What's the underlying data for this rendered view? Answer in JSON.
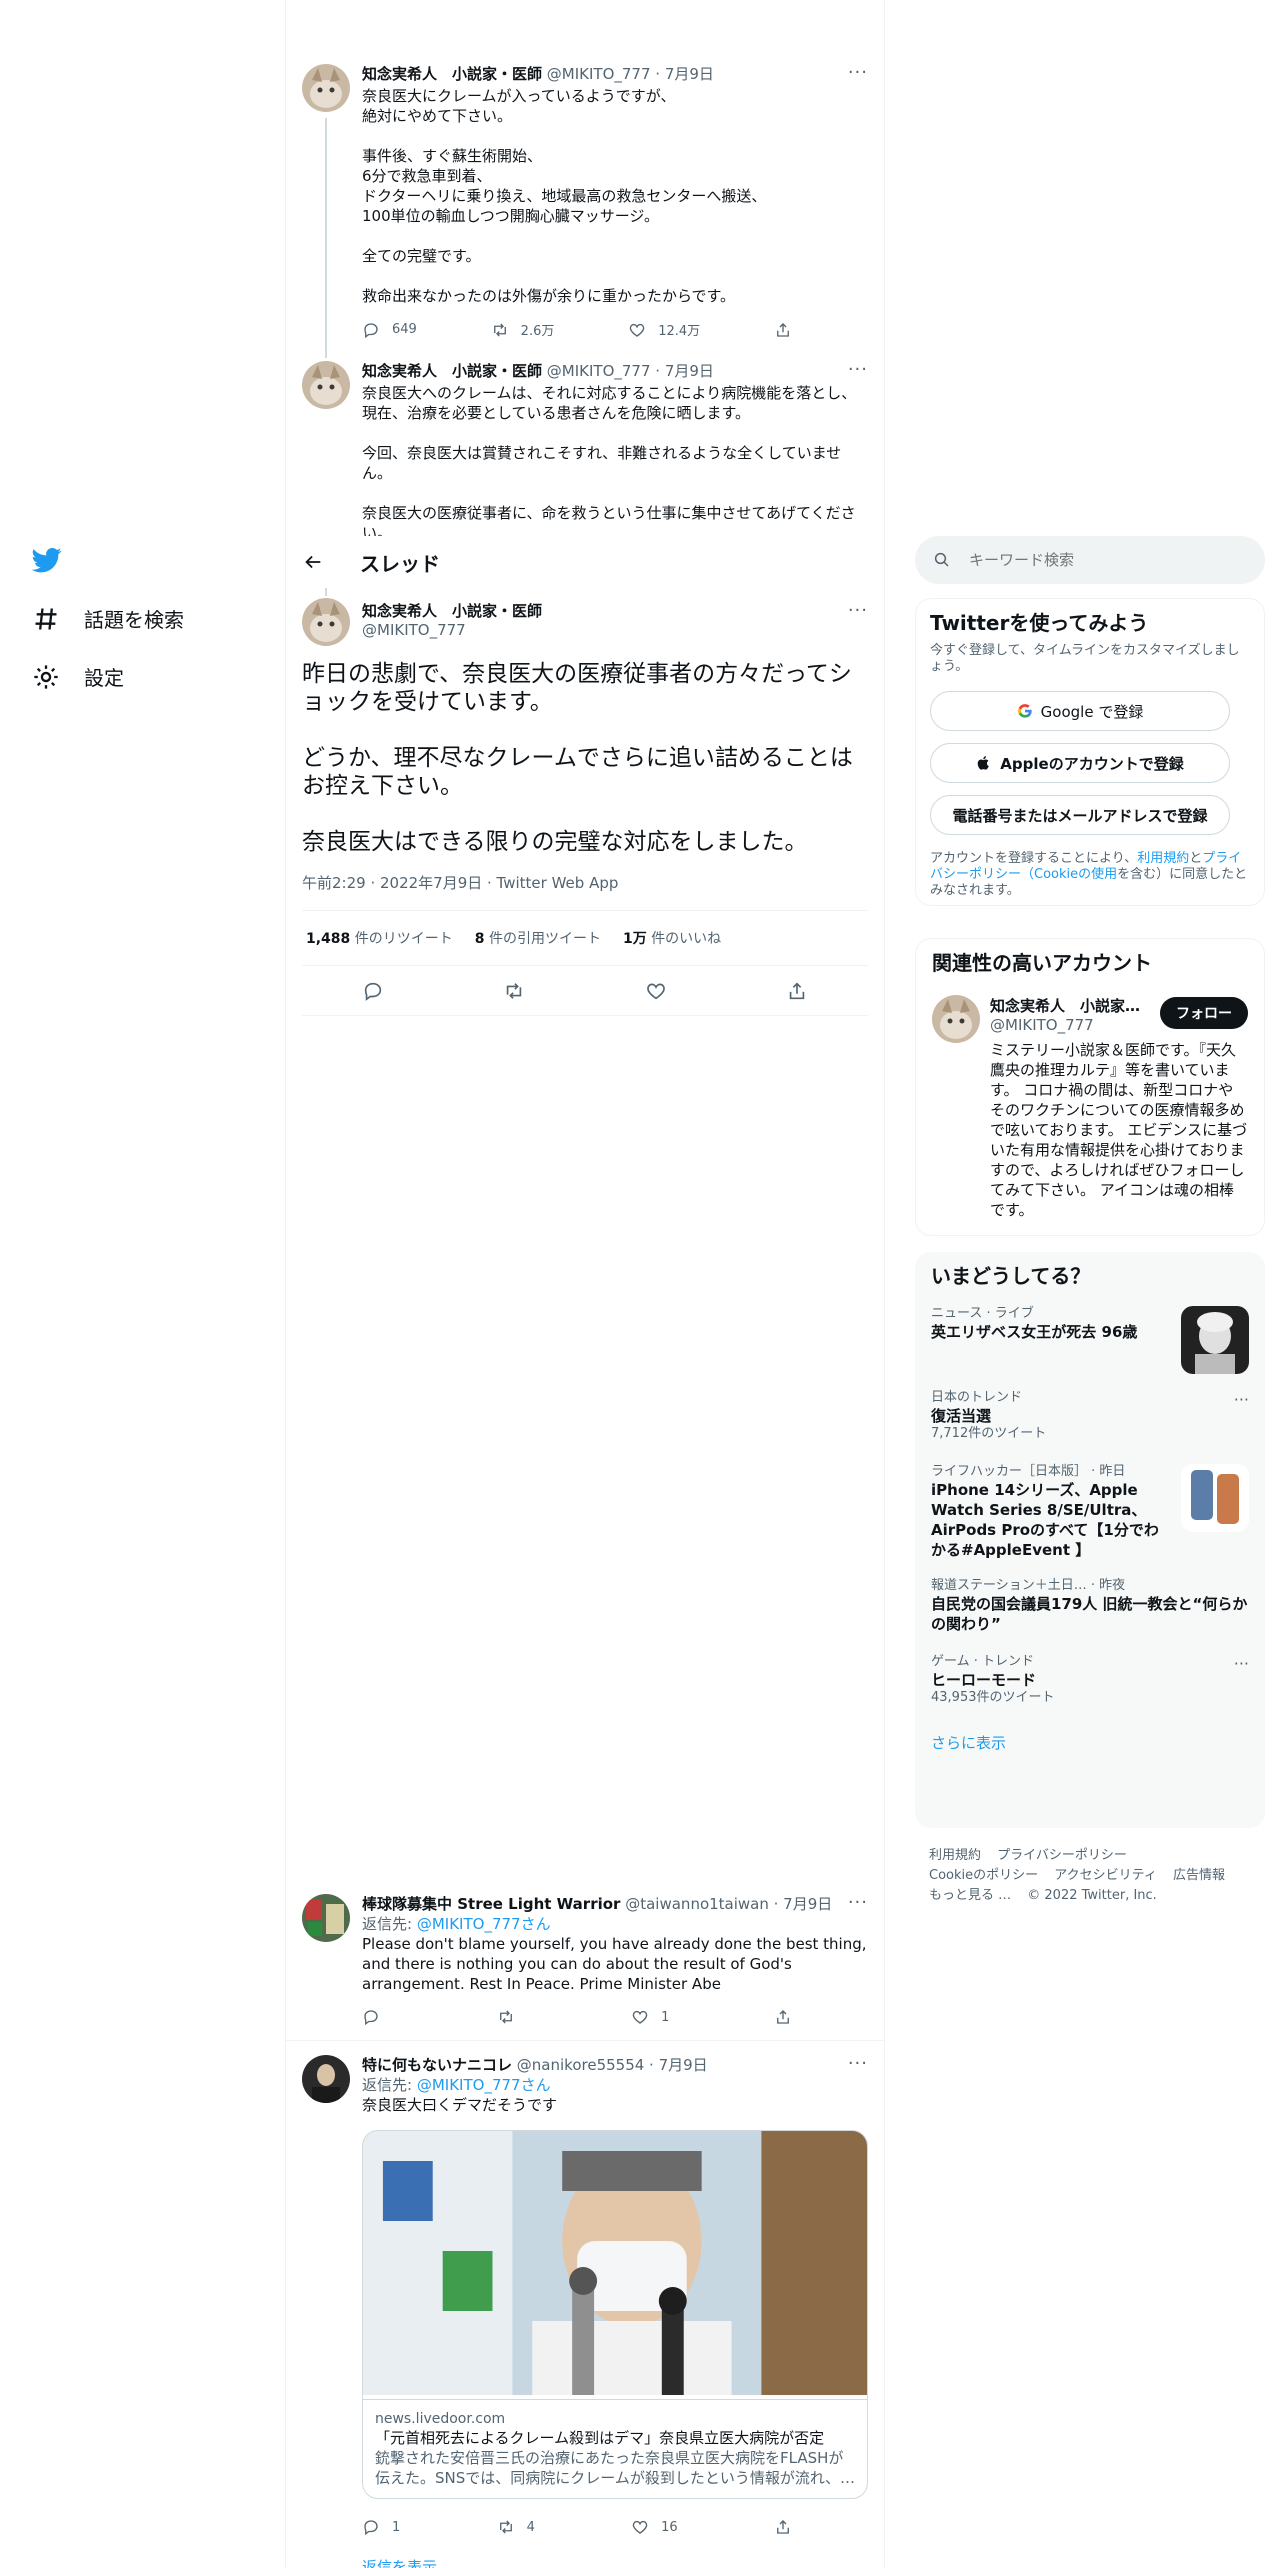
{
  "nav": {
    "explore_label": "話題を検索",
    "settings_label": "設定"
  },
  "header": {
    "title": "スレッド"
  },
  "tweets_above": [
    {
      "name": "知念実希人　小説家・医師",
      "meta": "@MIKITO_777 · 7月9日",
      "text": "奈良医大にクレームが入っているようですが、\n絶対にやめて下さい。\n\n事件後、すぐ蘇生術開始、\n6分で救急車到着、\nドクターヘリに乗り換え、地域最高の救急センターへ搬送、\n100単位の輸血しつつ開胸心臓マッサージ。\n\n全ての完璧です。\n\n救命出来なかったのは外傷が余りに重かったからです。",
      "reply": "649",
      "retweet": "2.6万",
      "like": "12.4万"
    },
    {
      "name": "知念実希人　小説家・医師",
      "meta": "@MIKITO_777 · 7月9日",
      "text": "奈良医大へのクレームは、それに対応することにより病院機能を落とし、現在、治療を必要としている患者さんを危険に晒します。\n\n今回、奈良医大は賞賛されこそすれ、非難されるような全くしていません。\n\n奈良医大の医療従事者に、命を救うという仕事に集中させてあげてください。"
    }
  ],
  "focus": {
    "name": "知念実希人　小説家・医師",
    "handle": "@MIKITO_777",
    "text": "昨日の悲劇で、奈良医大の医療従事者の方々だってショックを受けています。\n\nどうか、理不尽なクレームでさらに追い詰めることはお控え下さい。\n\n奈良医大はできる限りの完璧な対応をしました。",
    "time": "午前2:29 · 2022年7月9日 · Twitter Web App",
    "retweets_num": "1,488",
    "retweets_label": "件のリツイート",
    "quotes_num": "8",
    "quotes_label": "件の引用ツイート",
    "likes_num": "1万",
    "likes_label": "件のいいね"
  },
  "replies": [
    {
      "name": "棒球隊募集中 Stree Light Warrior",
      "meta": "@taiwanno1taiwan · 7月9日",
      "reply_to_label": "返信先:",
      "reply_to_mention": "@MIKITO_777さん",
      "text": "Please don't blame yourself, you have already done the best thing, and there is nothing you can do about the result of God's arrangement. Rest In Peace. Prime Minister Abe",
      "reply": "",
      "retweet": "",
      "like": "1"
    },
    {
      "name": "特に何もないナニコレ",
      "meta": "@nanikore55554 · 7月9日",
      "reply_to_label": "返信先:",
      "reply_to_mention": "@MIKITO_777さん",
      "text": "奈良医大曰くデマだそうです",
      "card_domain": "news.livedoor.com",
      "card_title": "「元首相死去によるクレーム殺到はデマ」奈良県立医大病院が否定",
      "card_desc": "銃撃された安倍晋三氏の治療にあたった奈良県立医大病院をFLASHが伝えた。SNSでは、同病院にクレームが殺到したという情報が流れ、…",
      "reply": "1",
      "retweet": "4",
      "like": "16"
    }
  ],
  "show_replies": "返信を表示",
  "search": {
    "placeholder": "キーワード検索"
  },
  "signup": {
    "title": "Twitterを使ってみよう",
    "subtitle": "今すぐ登録して、タイムラインをカスタマイズしましょう。",
    "google": "Google で登録",
    "apple": "Appleのアカウントで登録",
    "phone": "電話番号またはメールアドレスで登録",
    "legal_1": "アカウントを登録することにより、",
    "legal_terms": "利用規約",
    "legal_2": "と",
    "legal_privacy": "プライバシーポリシー（Cookieの使用",
    "legal_3": "を含む）に同意したとみなされます。"
  },
  "relevant": {
    "title": "関連性の高いアカウント",
    "name": "知念実希人　小説家…",
    "handle": "@MIKITO_777",
    "follow": "フォロー",
    "bio": "ミステリー小説家＆医師です。『天久鷹央の推理カルテ』等を書いています。 コロナ禍の間は、新型コロナやそのワクチンについての医療情報多めで呟いております。 エビデンスに基づいた有用な情報提供を心掛けておりますので、よろしければぜひフォローしてみて下さい。 アイコンは魂の相棒です。"
  },
  "trends": {
    "title": "いまどうしてる？",
    "items": [
      {
        "context": "ニュース · ライブ",
        "title": "英エリザベス女王が死去 96歳"
      },
      {
        "context": "日本のトレンド",
        "title": "復活当選",
        "count": "7,712件のツイート"
      },
      {
        "context": "ライフハッカー［日本版］ · 昨日",
        "title": "iPhone 14シリーズ、Apple Watch Series 8/SE/Ultra、AirPods Proのすべて【1分でわかる#AppleEvent 】"
      },
      {
        "context": "報道ステーション＋土日… · 昨夜",
        "title": "自民党の国会議員179人 旧統一教会と“何らかの関わり”"
      },
      {
        "context": "ゲーム · トレンド",
        "title": "ヒーローモード",
        "count": "43,953件のツイート"
      }
    ],
    "show_more": "さらに表示"
  },
  "footer": {
    "links": [
      "利用規約",
      "プライバシーポリシー",
      "Cookieのポリシー",
      "アクセシビリティ",
      "広告情報",
      "もっと見る …",
      "© 2022 Twitter, Inc."
    ]
  },
  "colors": {
    "accent": "#1d9bf0",
    "text": "#0f1419",
    "muted": "#536471"
  }
}
